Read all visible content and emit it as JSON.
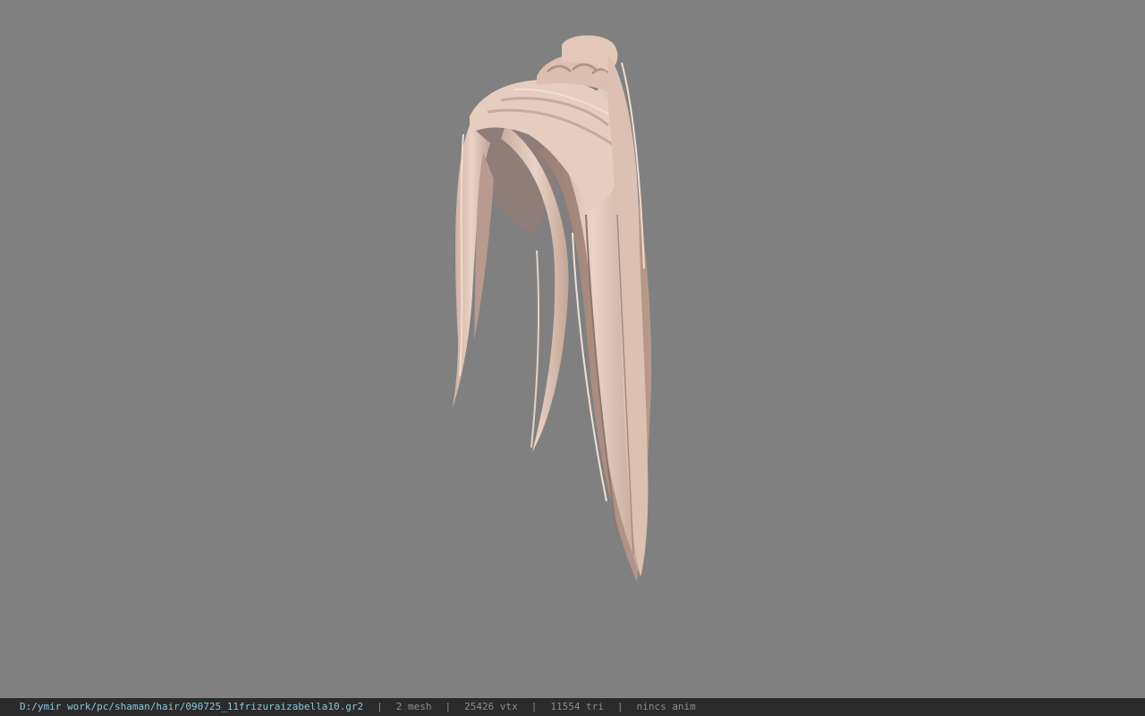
{
  "viewer": {
    "background_color": "#808080",
    "model_color": "#e0c6b8",
    "model_icon": "hair-model-icon"
  },
  "status": {
    "file_path": "D:/ymir work/pc/shaman/hair/090725_11frizuraizabella10.gr2",
    "mesh": "2 mesh",
    "vertices": "25426 vtx",
    "triangles": "11554 tri",
    "animation": "nincs anim",
    "separator": "|",
    "bar_color": "#2b2b2b",
    "path_color": "#86c6dc"
  }
}
